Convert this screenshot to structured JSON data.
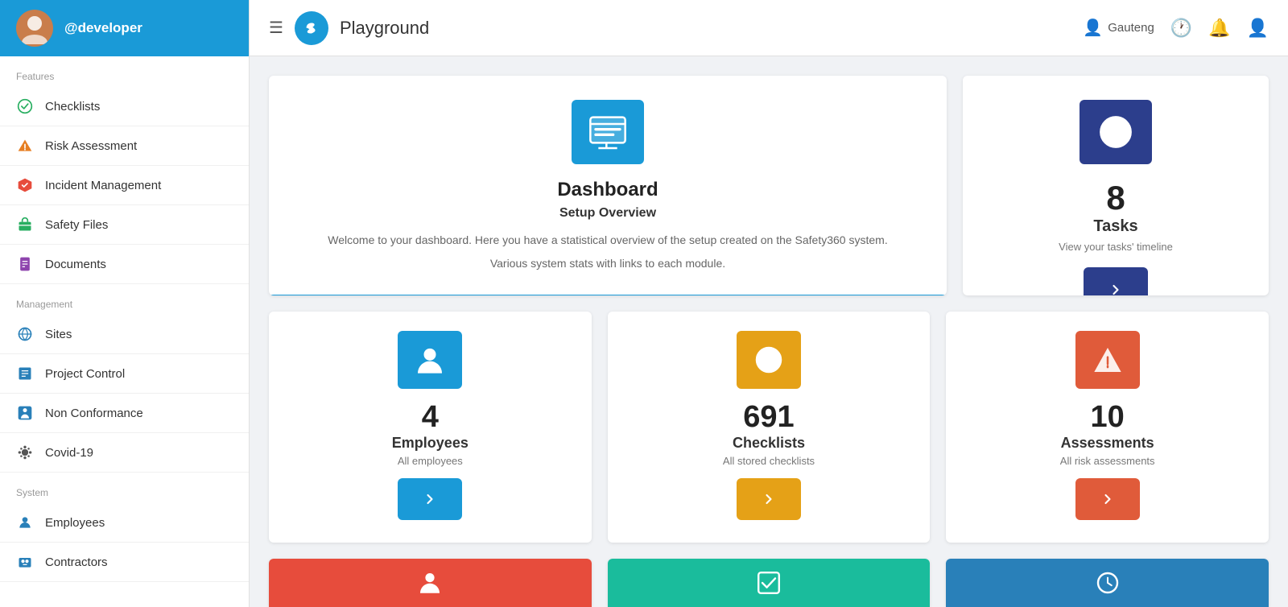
{
  "sidebar": {
    "username": "@developer",
    "sections": [
      {
        "label": "Features",
        "items": [
          {
            "id": "checklists",
            "label": "Checklists",
            "icon": "check-circle"
          },
          {
            "id": "risk-assessment",
            "label": "Risk Assessment",
            "icon": "warning-triangle"
          },
          {
            "id": "incident-management",
            "label": "Incident Management",
            "icon": "incident-cross"
          },
          {
            "id": "safety-files",
            "label": "Safety Files",
            "icon": "briefcase"
          },
          {
            "id": "documents",
            "label": "Documents",
            "icon": "document"
          }
        ]
      },
      {
        "label": "Management",
        "items": [
          {
            "id": "sites",
            "label": "Sites",
            "icon": "globe"
          },
          {
            "id": "project-control",
            "label": "Project Control",
            "icon": "project"
          },
          {
            "id": "non-conformance",
            "label": "Non Conformance",
            "icon": "non-conf"
          },
          {
            "id": "covid-19",
            "label": "Covid-19",
            "icon": "covid"
          }
        ]
      },
      {
        "label": "System",
        "items": [
          {
            "id": "employees",
            "label": "Employees",
            "icon": "person"
          },
          {
            "id": "contractors",
            "label": "Contractors",
            "icon": "contractors"
          }
        ]
      }
    ]
  },
  "topbar": {
    "logo_text": "∞",
    "title": "Playground",
    "region": "Gauteng"
  },
  "dashboard": {
    "icon_label": "dashboard-icon",
    "title": "Dashboard",
    "subtitle": "Setup Overview",
    "desc1": "Welcome to your dashboard. Here you have a statistical overview of the setup created on the Safety360 system.",
    "desc2": "Various system stats with links to each module."
  },
  "tasks": {
    "count": "8",
    "label": "Tasks",
    "sublabel": "View your tasks' timeline"
  },
  "stats": [
    {
      "id": "employees",
      "count": "4",
      "label": "Employees",
      "sublabel": "All employees",
      "color": "blue"
    },
    {
      "id": "checklists",
      "count": "691",
      "label": "Checklists",
      "sublabel": "All stored checklists",
      "color": "orange"
    },
    {
      "id": "assessments",
      "count": "10",
      "label": "Assessments",
      "sublabel": "All risk assessments",
      "color": "red"
    }
  ]
}
